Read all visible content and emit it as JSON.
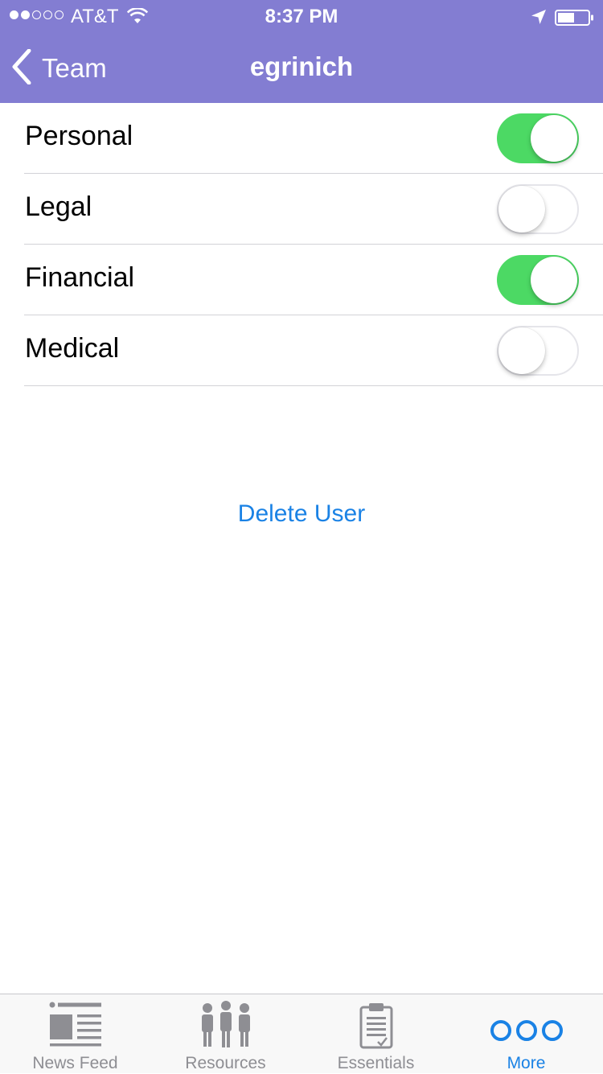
{
  "status_bar": {
    "carrier": "AT&T",
    "time": "8:37 PM",
    "signal_bars_filled": 2,
    "signal_bars_total": 5
  },
  "nav": {
    "back_label": "Team",
    "title": "egrinich"
  },
  "permissions": [
    {
      "label": "Personal",
      "enabled": true
    },
    {
      "label": "Legal",
      "enabled": false
    },
    {
      "label": "Financial",
      "enabled": true
    },
    {
      "label": "Medical",
      "enabled": false
    }
  ],
  "actions": {
    "delete_label": "Delete User"
  },
  "tab_bar": {
    "tabs": [
      {
        "label": "News Feed",
        "icon": "news-feed-icon",
        "active": false
      },
      {
        "label": "Resources",
        "icon": "people-icon",
        "active": false
      },
      {
        "label": "Essentials",
        "icon": "clipboard-icon",
        "active": false
      },
      {
        "label": "More",
        "icon": "more-icon",
        "active": true
      }
    ]
  },
  "colors": {
    "header_bg": "#837dd2",
    "switch_on": "#4cd964",
    "link_blue": "#1a82e5",
    "tab_inactive": "#8e8e93"
  }
}
